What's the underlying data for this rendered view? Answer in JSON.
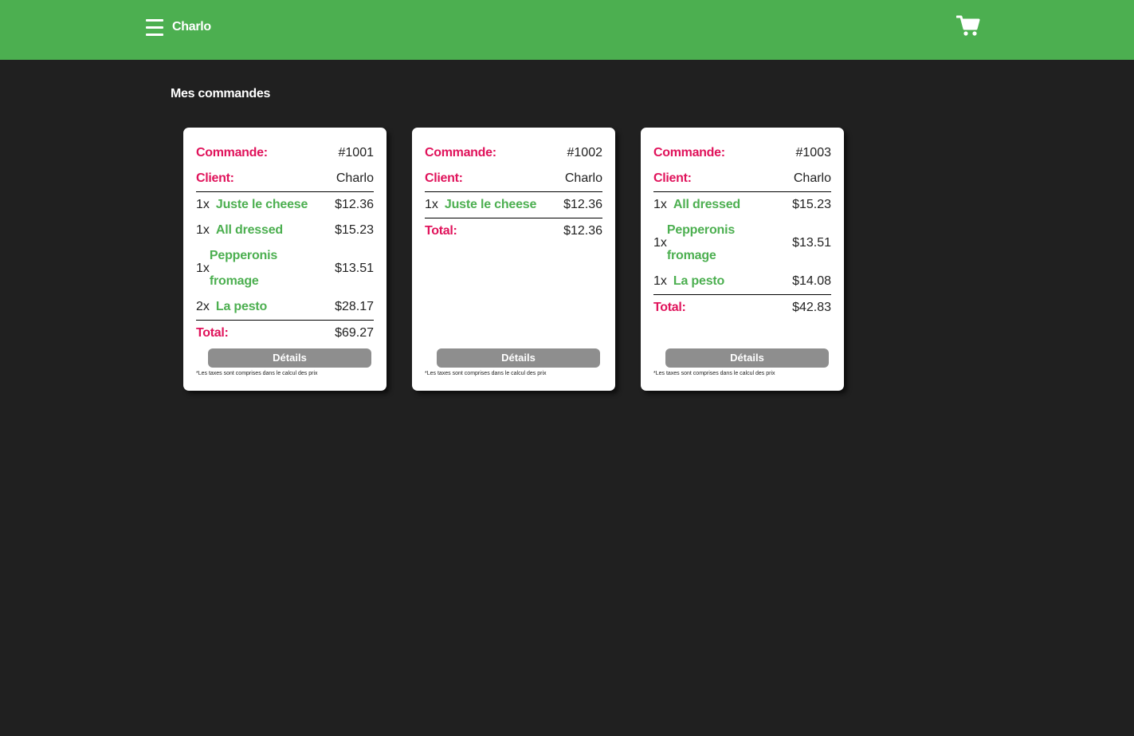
{
  "header": {
    "username": "Charlo",
    "menu_icon": "hamburger-menu-icon",
    "cart_icon": "shopping-cart-icon",
    "bg_color": "#4caf50"
  },
  "page": {
    "title": "Mes commandes"
  },
  "labels": {
    "order": "Commande:",
    "client": "Client:",
    "total": "Total:",
    "details": "Détails",
    "tax_note": "*Les taxes sont comprises dans le calcul des prix"
  },
  "orders": [
    {
      "id": "#1001",
      "client": "Charlo",
      "items": [
        {
          "qty": "1x",
          "name": "Juste le cheese",
          "price": "$12.36"
        },
        {
          "qty": "1x",
          "name": "All dressed",
          "price": "$15.23"
        },
        {
          "qty": "1x",
          "name": "Pepperonis fromage",
          "price": "$13.51"
        },
        {
          "qty": "2x",
          "name": "La pesto",
          "price": "$28.17"
        }
      ],
      "total": "$69.27"
    },
    {
      "id": "#1002",
      "client": "Charlo",
      "items": [
        {
          "qty": "1x",
          "name": "Juste le cheese",
          "price": "$12.36"
        }
      ],
      "total": "$12.36"
    },
    {
      "id": "#1003",
      "client": "Charlo",
      "items": [
        {
          "qty": "1x",
          "name": "All dressed",
          "price": "$15.23"
        },
        {
          "qty": "1x",
          "name": "Pepperonis fromage",
          "price": "$13.51"
        },
        {
          "qty": "1x",
          "name": "La pesto",
          "price": "$14.08"
        }
      ],
      "total": "$42.83"
    }
  ]
}
